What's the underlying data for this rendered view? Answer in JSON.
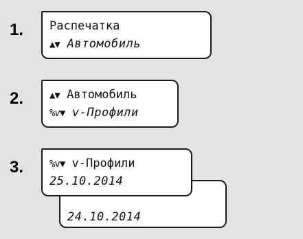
{
  "steps": [
    {
      "number": "1.",
      "line1": {
        "icon": "",
        "text": "Распечатка"
      },
      "line2": {
        "icon": "▲▼",
        "text": " Автомобиль"
      }
    },
    {
      "number": "2.",
      "line1": {
        "icon": "▲▼",
        "text": " Автомобиль"
      },
      "line2": {
        "icon": "%v▼",
        "text": " v-Профили"
      }
    },
    {
      "number": "3.",
      "line1": {
        "icon": "%v▼",
        "text": " v-Профили"
      },
      "line2": {
        "icon": "",
        "text": "25.10.2014"
      },
      "line3": {
        "icon": "",
        "text": "24.10.2014"
      }
    }
  ]
}
